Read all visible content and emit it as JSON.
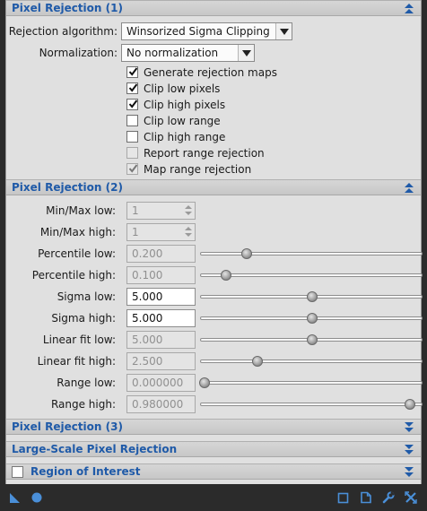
{
  "sections": {
    "rej1": {
      "title": "Pixel Rejection (1)",
      "state": "expanded"
    },
    "rej2": {
      "title": "Pixel Rejection (2)",
      "state": "expanded"
    },
    "rej3": {
      "title": "Pixel Rejection (3)",
      "state": "collapsed"
    },
    "large": {
      "title": "Large-Scale Pixel Rejection",
      "state": "collapsed"
    },
    "roi": {
      "title": "Region of Interest",
      "state": "collapsed",
      "checked": false
    }
  },
  "rej1": {
    "algorithm_label": "Rejection algorithm:",
    "algorithm_value": "Winsorized Sigma Clipping",
    "normalization_label": "Normalization:",
    "normalization_value": "No normalization",
    "checks": [
      {
        "label": "Generate rejection maps",
        "checked": true,
        "enabled": true
      },
      {
        "label": "Clip low pixels",
        "checked": true,
        "enabled": true
      },
      {
        "label": "Clip high pixels",
        "checked": true,
        "enabled": true
      },
      {
        "label": "Clip low range",
        "checked": false,
        "enabled": true
      },
      {
        "label": "Clip high range",
        "checked": false,
        "enabled": true
      },
      {
        "label": "Report range rejection",
        "checked": false,
        "enabled": false
      },
      {
        "label": "Map range rejection",
        "checked": true,
        "enabled": false
      }
    ]
  },
  "rej2": {
    "minmax_low_label": "Min/Max low:",
    "minmax_low_value": "1",
    "minmax_high_label": "Min/Max high:",
    "minmax_high_value": "1",
    "params": [
      {
        "label": "Percentile low:",
        "value": "0.200",
        "enabled": false,
        "slider_fraction": 0.21
      },
      {
        "label": "Percentile high:",
        "value": "0.100",
        "enabled": false,
        "slider_fraction": 0.115
      },
      {
        "label": "Sigma low:",
        "value": "5.000",
        "enabled": true,
        "slider_fraction": 0.505
      },
      {
        "label": "Sigma high:",
        "value": "5.000",
        "enabled": true,
        "slider_fraction": 0.505
      },
      {
        "label": "Linear fit low:",
        "value": "5.000",
        "enabled": false,
        "slider_fraction": 0.505
      },
      {
        "label": "Linear fit high:",
        "value": "2.500",
        "enabled": false,
        "slider_fraction": 0.26
      },
      {
        "label": "Range low:",
        "value": "0.000000",
        "enabled": false,
        "slider_fraction": 0.02
      },
      {
        "label": "Range high:",
        "value": "0.980000",
        "enabled": false,
        "slider_fraction": 0.945
      }
    ]
  },
  "footer": {
    "icons": [
      "new-instance-icon",
      "apply-global-icon",
      "preview-icon",
      "document-icon",
      "wrench-icon",
      "reset-icon"
    ]
  },
  "colors": {
    "section_title": "#1f5aa8",
    "panel_bg": "#e0e0e0",
    "window_bg": "#2b2b2b"
  }
}
